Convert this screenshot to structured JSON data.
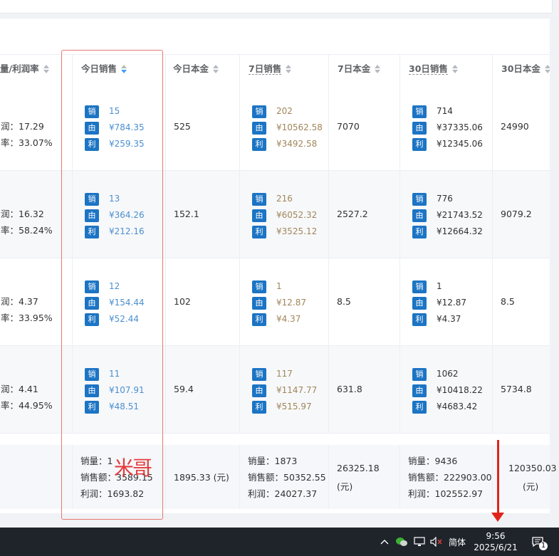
{
  "headers": [
    {
      "label": "量/利润率",
      "sort": "none",
      "dashed": false
    },
    {
      "label": "今日销售",
      "sort": "desc",
      "dashed": false
    },
    {
      "label": "今日本金",
      "sort": "none",
      "dashed": false
    },
    {
      "label": "7日销售",
      "sort": "none",
      "dashed": true
    },
    {
      "label": "7日本金",
      "sort": "none",
      "dashed": false
    },
    {
      "label": "30日销售",
      "sort": "none",
      "dashed": true
    },
    {
      "label": "30日本金",
      "sort": "none",
      "dashed": false
    }
  ],
  "badges": {
    "sales": "销",
    "revenue": "由",
    "profit": "利"
  },
  "rows": [
    {
      "profit_line": "润：17.29",
      "rate_line": "率：33.07%",
      "today": {
        "qty": "15",
        "rev": "¥784.35",
        "profit": "¥259.35"
      },
      "today_cost": "525",
      "d7": {
        "qty": "202",
        "rev": "¥10562.58",
        "profit": "¥3492.58"
      },
      "d7_cost": "7070",
      "d30": {
        "qty": "714",
        "rev": "¥37335.06",
        "profit": "¥12345.06"
      },
      "d30_cost": "24990"
    },
    {
      "profit_line": "润：16.32",
      "rate_line": "率：58.24%",
      "today": {
        "qty": "13",
        "rev": "¥364.26",
        "profit": "¥212.16"
      },
      "today_cost": "152.1",
      "d7": {
        "qty": "216",
        "rev": "¥6052.32",
        "profit": "¥3525.12"
      },
      "d7_cost": "2527.2",
      "d30": {
        "qty": "776",
        "rev": "¥21743.52",
        "profit": "¥12664.32"
      },
      "d30_cost": "9079.2"
    },
    {
      "profit_line": "润：4.37",
      "rate_line": "率：33.95%",
      "today": {
        "qty": "12",
        "rev": "¥154.44",
        "profit": "¥52.44"
      },
      "today_cost": "102",
      "d7": {
        "qty": "1",
        "rev": "¥12.87",
        "profit": "¥4.37"
      },
      "d7_cost": "8.5",
      "d30": {
        "qty": "1",
        "rev": "¥12.87",
        "profit": "¥4.37"
      },
      "d30_cost": "8.5"
    },
    {
      "profit_line": "润：4.41",
      "rate_line": "率：44.95%",
      "today": {
        "qty": "11",
        "rev": "¥107.91",
        "profit": "¥48.51"
      },
      "today_cost": "59.4",
      "d7": {
        "qty": "117",
        "rev": "¥1147.77",
        "profit": "¥515.97"
      },
      "d7_cost": "631.8",
      "d30": {
        "qty": "1062",
        "rev": "¥10418.22",
        "profit": "¥4683.42"
      },
      "d30_cost": "5734.8"
    }
  ],
  "summary": {
    "today": {
      "qty": "销量：1",
      "rev": "销售额：3589.15",
      "profit": "利润：1693.82"
    },
    "today_cost": "1895.33 (元)",
    "d7": {
      "qty": "销量：1873",
      "rev": "销售额：50352.55",
      "profit": "利润：24027.37"
    },
    "d7_cost_1": "26325.18",
    "d7_cost_2": "(元)",
    "d30": {
      "qty": "销量：9436",
      "rev": "销售额：222903.00",
      "profit": "利润：102552.97"
    },
    "d30_cost_1": "120350.03",
    "d30_cost_2": "(元)"
  },
  "watermark": "米哥",
  "taskbar": {
    "ime": "简体",
    "time": "9:56",
    "date": "2025/6/21",
    "notif_count": "1"
  },
  "colors": {
    "badge": "#1c74c4",
    "today_value": "#4a8fd0",
    "d7_value": "#a0865a",
    "highlight_box": "#e8776f",
    "arrow": "#e0241b"
  }
}
